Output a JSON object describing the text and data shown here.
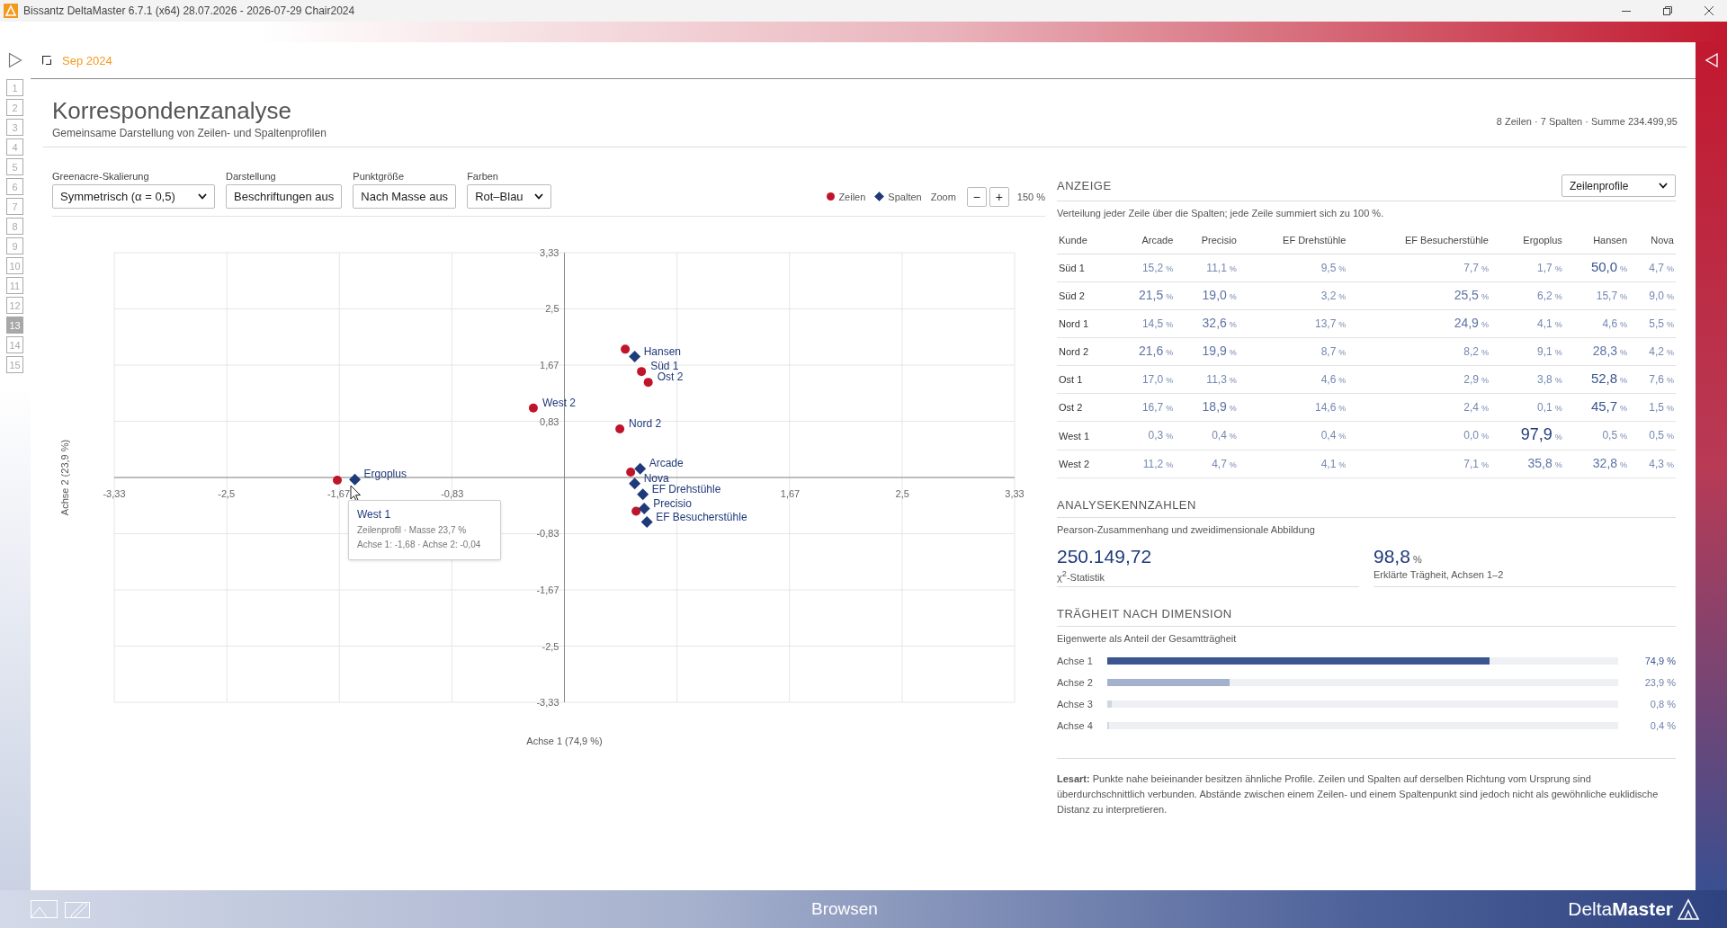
{
  "title_bar": {
    "title": "Bissantz DeltaMaster 6.7.1 (x64) 28.07.2026 - 2026-07-29 Chair2024"
  },
  "page_nav": [
    {
      "label": "1",
      "selected": false
    },
    {
      "label": "2",
      "selected": false
    },
    {
      "label": "3",
      "selected": false
    },
    {
      "label": "4",
      "selected": false
    },
    {
      "label": "5",
      "selected": false
    },
    {
      "label": "6",
      "selected": false
    },
    {
      "label": "7",
      "selected": false
    },
    {
      "label": "8",
      "selected": false
    },
    {
      "label": "9",
      "selected": false
    },
    {
      "label": "10",
      "selected": false
    },
    {
      "label": "11",
      "selected": false
    },
    {
      "label": "12",
      "selected": false
    },
    {
      "label": "13",
      "selected": true
    },
    {
      "label": "14",
      "selected": false
    },
    {
      "label": "15",
      "selected": false
    }
  ],
  "breadcrumb": {
    "period": "Sep 2024"
  },
  "report": {
    "title": "Korrespondenzanalyse",
    "subtitle": "Gemeinsame Darstellung von Zeilen- und Spaltenprofilen",
    "summary": "8 Zeilen · 7 Spalten · Summe 234.499,95"
  },
  "controls": [
    {
      "kind": "dropdown",
      "label": "Greenacre-Skalierung",
      "value": "Symmetrisch (α = 0,5)"
    },
    {
      "kind": "button",
      "label": "Darstellung",
      "value": "Beschriftungen aus"
    },
    {
      "kind": "button",
      "label": "Punktgröße",
      "value": "Nach Masse aus"
    },
    {
      "kind": "dropdown",
      "label": "Farben",
      "value": "Rot–Blau"
    }
  ],
  "zoom": {
    "label": "Zoom",
    "minus": "−",
    "plus": "+",
    "value": "150 %"
  },
  "chart": {
    "chart_data": {
      "type": "scatter",
      "xlabel": "Achse 1 (74,9 %)",
      "ylabel": "Achse 2 (23,9 %)",
      "xlim": [
        -3.33,
        3.33
      ],
      "ylim": [
        -3.33,
        3.33
      ],
      "xticks": [
        {
          "value": -3.33,
          "label": "-3,33"
        },
        {
          "value": -2.5,
          "label": "-2,5"
        },
        {
          "value": -1.67,
          "label": "-1,67"
        },
        {
          "value": -0.83,
          "label": "-0,83"
        },
        {
          "value": 1.67,
          "label": "1,67"
        },
        {
          "value": 2.5,
          "label": "2,5"
        },
        {
          "value": 3.33,
          "label": "3,33"
        }
      ],
      "yticks": [
        {
          "value": 3.33,
          "label": "3,33"
        },
        {
          "value": 2.5,
          "label": "2,5"
        },
        {
          "value": 1.67,
          "label": "1,67"
        },
        {
          "value": 0.83,
          "label": "0,83"
        },
        {
          "value": -0.83,
          "label": "-0,83"
        },
        {
          "value": -1.67,
          "label": "-1,67"
        },
        {
          "value": -2.5,
          "label": "-2,5"
        },
        {
          "value": -3.33,
          "label": "-3,33"
        }
      ],
      "grid": true,
      "x": [
        0.49,
        -0.23,
        0.41,
        0.57,
        0.62,
        0.45,
        -1.68,
        0.53,
        0.52,
        0.52,
        0.56,
        0.58,
        0.59,
        0.61,
        -1.55
      ],
      "series": [
        {
          "name": "Zeilen",
          "color": "#c0142a",
          "values": [
            0.08,
            1.03,
            0.72,
            1.57,
            1.41,
            1.9,
            -0.04,
            -0.5,
            null,
            null,
            null,
            null,
            null,
            null,
            null
          ]
        },
        {
          "name": "Spalten",
          "color": "#1f3a7a",
          "values": [
            null,
            null,
            null,
            null,
            null,
            null,
            null,
            null,
            -0.09,
            1.79,
            0.13,
            -0.25,
            -0.46,
            -0.66,
            -0.03
          ]
        }
      ],
      "annotations": [
        {
          "x": -0.23,
          "y": 1.03,
          "text": "West 2"
        },
        {
          "x": 0.41,
          "y": 0.72,
          "text": "Nord 2"
        },
        {
          "x": 0.57,
          "y": 1.57,
          "text": "Süd 1"
        },
        {
          "x": 0.62,
          "y": 1.41,
          "text": "Ost 2"
        },
        {
          "x": 0.52,
          "y": -0.09,
          "text": "Nova"
        },
        {
          "x": 0.52,
          "y": 1.79,
          "text": "Hansen"
        },
        {
          "x": 0.56,
          "y": 0.13,
          "text": "Arcade"
        },
        {
          "x": 0.58,
          "y": -0.25,
          "text": "EF Drehstühle"
        },
        {
          "x": 0.59,
          "y": -0.46,
          "text": "Precisio"
        },
        {
          "x": 0.61,
          "y": -0.66,
          "text": "EF Besucherstühle"
        },
        {
          "x": -1.55,
          "y": -0.03,
          "text": "Ergoplus"
        }
      ]
    },
    "tooltip": {
      "title": "West 1",
      "line_1": "Zeilenprofil · Masse 23,7 %",
      "line_2": "Achse 1: -1,68 · Achse 2: -0,04"
    }
  },
  "display": {
    "heading": "ANZEIGE",
    "mode": "Zeilenprofile",
    "description": "Verteilung jeder Zeile über die Spalten; jede Zeile summiert sich zu 100 %.",
    "table": {
      "columns": [
        "Kunde",
        "Arcade",
        "Precisio",
        "EF Drehstühle",
        "EF Besucherstühle",
        "Ergoplus",
        "Hansen",
        "Nova"
      ],
      "rows": [
        {
          "cells": [
            {
              "kind": "label",
              "value": "Süd 1"
            },
            {
              "value": "15,2",
              "unit": "%",
              "kind": "small"
            },
            {
              "value": "11,1",
              "unit": "%",
              "kind": "small"
            },
            {
              "value": "9,5",
              "unit": "%",
              "kind": "small"
            },
            {
              "value": "7,7",
              "unit": "%",
              "kind": "small"
            },
            {
              "value": "1,7",
              "unit": "%",
              "kind": "small"
            },
            {
              "value": "50,0",
              "unit": "%",
              "kind": "large"
            },
            {
              "value": "4,7",
              "unit": "%",
              "kind": "small"
            }
          ]
        },
        {
          "cells": [
            {
              "kind": "label",
              "value": "Süd 2"
            },
            {
              "value": "21,5",
              "unit": "%",
              "kind": "medium"
            },
            {
              "value": "19,0",
              "unit": "%",
              "kind": "medium"
            },
            {
              "value": "3,2",
              "unit": "%",
              "kind": "small"
            },
            {
              "value": "25,5",
              "unit": "%",
              "kind": "medium"
            },
            {
              "value": "6,2",
              "unit": "%",
              "kind": "small"
            },
            {
              "value": "15,7",
              "unit": "%",
              "kind": "small"
            },
            {
              "value": "9,0",
              "unit": "%",
              "kind": "small"
            }
          ]
        },
        {
          "cells": [
            {
              "kind": "label",
              "value": "Nord 1"
            },
            {
              "value": "14,5",
              "unit": "%",
              "kind": "small"
            },
            {
              "value": "32,6",
              "unit": "%",
              "kind": "medium"
            },
            {
              "value": "13,7",
              "unit": "%",
              "kind": "small"
            },
            {
              "value": "24,9",
              "unit": "%",
              "kind": "medium"
            },
            {
              "value": "4,1",
              "unit": "%",
              "kind": "small"
            },
            {
              "value": "4,6",
              "unit": "%",
              "kind": "small"
            },
            {
              "value": "5,5",
              "unit": "%",
              "kind": "small"
            }
          ]
        },
        {
          "cells": [
            {
              "kind": "label",
              "value": "Nord 2"
            },
            {
              "value": "21,6",
              "unit": "%",
              "kind": "medium"
            },
            {
              "value": "19,9",
              "unit": "%",
              "kind": "medium"
            },
            {
              "value": "8,7",
              "unit": "%",
              "kind": "small"
            },
            {
              "value": "8,2",
              "unit": "%",
              "kind": "small"
            },
            {
              "value": "9,1",
              "unit": "%",
              "kind": "small"
            },
            {
              "value": "28,3",
              "unit": "%",
              "kind": "medium"
            },
            {
              "value": "4,2",
              "unit": "%",
              "kind": "small"
            }
          ]
        },
        {
          "cells": [
            {
              "kind": "label",
              "value": "Ost 1"
            },
            {
              "value": "17,0",
              "unit": "%",
              "kind": "small"
            },
            {
              "value": "11,3",
              "unit": "%",
              "kind": "small"
            },
            {
              "value": "4,6",
              "unit": "%",
              "kind": "small"
            },
            {
              "value": "2,9",
              "unit": "%",
              "kind": "small"
            },
            {
              "value": "3,8",
              "unit": "%",
              "kind": "small"
            },
            {
              "value": "52,8",
              "unit": "%",
              "kind": "large"
            },
            {
              "value": "7,6",
              "unit": "%",
              "kind": "small"
            }
          ]
        },
        {
          "cells": [
            {
              "kind": "label",
              "value": "Ost 2"
            },
            {
              "value": "16,7",
              "unit": "%",
              "kind": "small"
            },
            {
              "value": "18,9",
              "unit": "%",
              "kind": "medium"
            },
            {
              "value": "14,6",
              "unit": "%",
              "kind": "small"
            },
            {
              "value": "2,4",
              "unit": "%",
              "kind": "small"
            },
            {
              "value": "0,1",
              "unit": "%",
              "kind": "small"
            },
            {
              "value": "45,7",
              "unit": "%",
              "kind": "large"
            },
            {
              "value": "1,5",
              "unit": "%",
              "kind": "small"
            }
          ]
        },
        {
          "cells": [
            {
              "kind": "label",
              "value": "West 1"
            },
            {
              "value": "0,3",
              "unit": "%",
              "kind": "small"
            },
            {
              "value": "0,4",
              "unit": "%",
              "kind": "small"
            },
            {
              "value": "0,4",
              "unit": "%",
              "kind": "small"
            },
            {
              "value": "0,0",
              "unit": "%",
              "kind": "small"
            },
            {
              "value": "97,9",
              "unit": "%",
              "kind": "xlarge"
            },
            {
              "value": "0,5",
              "unit": "%",
              "kind": "small"
            },
            {
              "value": "0,5",
              "unit": "%",
              "kind": "small"
            }
          ]
        },
        {
          "cells": [
            {
              "kind": "label",
              "value": "West 2"
            },
            {
              "value": "11,2",
              "unit": "%",
              "kind": "small"
            },
            {
              "value": "4,7",
              "unit": "%",
              "kind": "small"
            },
            {
              "value": "4,1",
              "unit": "%",
              "kind": "small"
            },
            {
              "value": "7,1",
              "unit": "%",
              "kind": "small"
            },
            {
              "value": "35,8",
              "unit": "%",
              "kind": "medium"
            },
            {
              "value": "32,8",
              "unit": "%",
              "kind": "medium"
            },
            {
              "value": "4,3",
              "unit": "%",
              "kind": "small"
            }
          ]
        }
      ]
    }
  },
  "metrics": {
    "heading": "ANALYSEKENNZAHLEN",
    "description": "Pearson-Zusammenhang und zweidimensionale Abbildung",
    "items": [
      {
        "value": "250.149,72",
        "label": "χ$^{2}$-Statistik"
      },
      {
        "value": "98,8",
        "unit": "%",
        "label": "Erklärte Trägheit, Achsen 1–2"
      }
    ]
  },
  "inertia": {
    "heading": "TRÄGHEIT NACH DIMENSION",
    "description": "Eigenwerte als Anteil der Gesamtträgheit",
    "bars": [
      {
        "label": "Achse 1",
        "level": 0.749,
        "value": "74,9 %",
        "color": "#3a5590"
      },
      {
        "label": "Achse 2",
        "level": 0.239,
        "value": "23,9 %",
        "color": "#a3b1cc"
      },
      {
        "label": "Achse 3",
        "level": 0.008,
        "value": "0,8 %",
        "color": "#cfd6e4"
      },
      {
        "label": "Achse 4",
        "level": 0.004,
        "value": "0,4 %",
        "color": "#cfd6e4"
      }
    ]
  },
  "note": "**Lesart:** Punkte nahe beieinander besitzen ähnliche Profile. Zeilen und Spalten auf derselben Richtung vom Ursprung sind überdurchschnittlich verbunden. Abstände zwischen einem Zeilen- und einem Spaltenpunkt sind jedoch nicht als gewöhnliche euklidische Distanz zu interpretieren.",
  "bottom_bar": {
    "mode": "Browsen",
    "logo": "Delta**Master**"
  }
}
